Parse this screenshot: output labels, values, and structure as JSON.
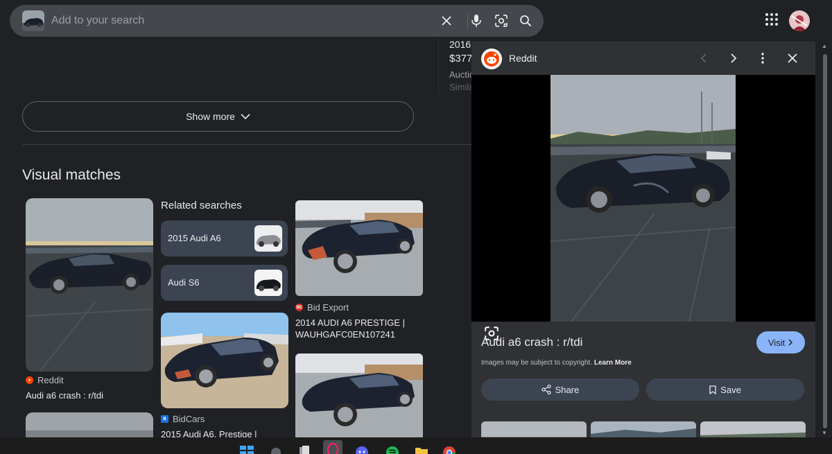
{
  "search": {
    "placeholder": "Add to your search"
  },
  "main": {
    "show_more_label": "Show more",
    "section_title": "Visual matches",
    "related_title": "Related searches",
    "related": [
      {
        "label": "2015 Audi A6"
      },
      {
        "label": "Audi S6"
      }
    ],
    "results": [
      {
        "source": "Reddit",
        "title": "Audi a6 crash : r/tdi"
      },
      {
        "source": "Bid Export",
        "title": "2014 AUDI A6 PRESTIGE | WAUHGAFC0EN107241"
      },
      {
        "source": "BidCars",
        "title": "2015 Audi A6, Prestige |"
      }
    ]
  },
  "background_peek": {
    "line1": "2016",
    "price": "$377",
    "line3": "Auctio",
    "line4": "Simila"
  },
  "panel": {
    "source": "Reddit",
    "title": "Audi a6 crash : r/tdi",
    "visit_label": "Visit",
    "copyright_text": "Images may be subject to copyright.",
    "learn_more": "Learn More",
    "share_label": "Share",
    "save_label": "Save"
  },
  "colors": {
    "background": "#202124",
    "search_bar": "#44474c",
    "panel": "#303134",
    "chip": "#3c4452",
    "accent": "#8ab4f8",
    "reddit": "#ff4500",
    "bid_export": "#d93025",
    "bidcars": "#1a73e8"
  },
  "icons": [
    "clear-icon",
    "mic-icon",
    "lens-icon",
    "search-icon",
    "apps-icon",
    "chevron-down-icon",
    "reddit-icon",
    "chevron-left-icon",
    "chevron-right-icon",
    "more-vert-icon",
    "close-icon",
    "share-icon",
    "bookmark-icon"
  ]
}
